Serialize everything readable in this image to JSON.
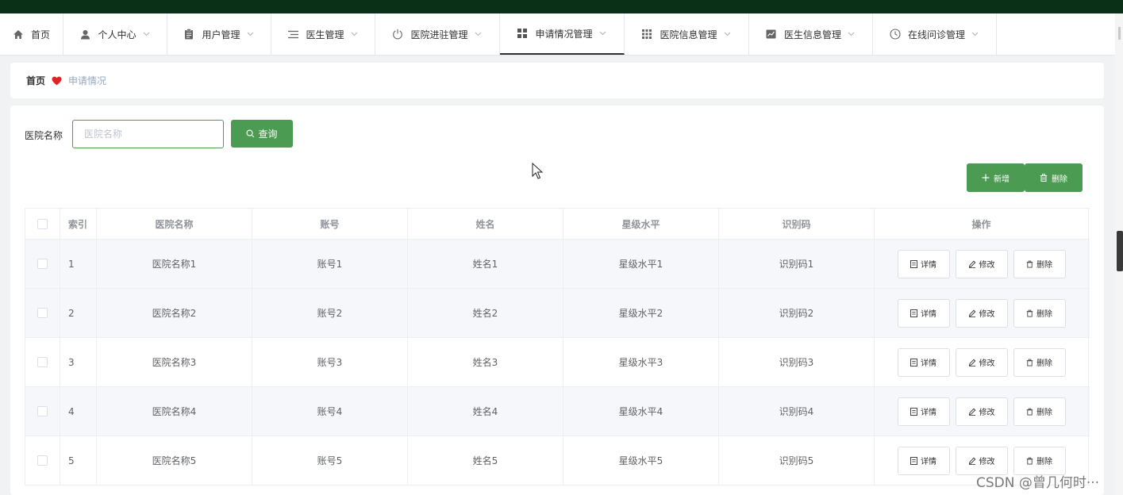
{
  "nav": {
    "items": [
      {
        "label": "首页",
        "icon": "home-icon",
        "chevron": false,
        "active": false
      },
      {
        "label": "个人中心",
        "icon": "user-icon",
        "chevron": true,
        "active": false
      },
      {
        "label": "用户管理",
        "icon": "clipboard-icon",
        "chevron": true,
        "active": false
      },
      {
        "label": "医生管理",
        "icon": "list-icon",
        "chevron": true,
        "active": false
      },
      {
        "label": "医院进驻管理",
        "icon": "power-icon",
        "chevron": true,
        "active": false
      },
      {
        "label": "申请情况管理",
        "icon": "grid-icon",
        "chevron": true,
        "active": true
      },
      {
        "label": "医院信息管理",
        "icon": "apps-icon",
        "chevron": true,
        "active": false
      },
      {
        "label": "医生信息管理",
        "icon": "chart-icon",
        "chevron": true,
        "active": false
      },
      {
        "label": "在线问诊管理",
        "icon": "clock-icon",
        "chevron": true,
        "active": false
      }
    ]
  },
  "breadcrumb": {
    "home": "首页",
    "current": "申请情况"
  },
  "search": {
    "label": "医院名称",
    "placeholder": "医院名称",
    "value": "",
    "button": "查询"
  },
  "actions": {
    "add": "新增",
    "delete": "删除"
  },
  "table": {
    "headers": [
      "索引",
      "医院名称",
      "账号",
      "姓名",
      "星级水平",
      "识别码",
      "操作"
    ],
    "rows": [
      [
        "1",
        "医院名称1",
        "账号1",
        "姓名1",
        "星级水平1",
        "识别码1"
      ],
      [
        "2",
        "医院名称2",
        "账号2",
        "姓名2",
        "星级水平2",
        "识别码2"
      ],
      [
        "3",
        "医院名称3",
        "账号3",
        "姓名3",
        "星级水平3",
        "识别码3"
      ],
      [
        "4",
        "医院名称4",
        "账号4",
        "姓名4",
        "星级水平4",
        "识别码4"
      ],
      [
        "5",
        "医院名称5",
        "账号5",
        "姓名5",
        "星级水平5",
        "识别码5"
      ]
    ],
    "row_actions": {
      "detail": "详情",
      "edit": "修改",
      "delete": "删除"
    }
  },
  "watermark": "CSDN @曾几何时···",
  "colors": {
    "primary": "#4b9b52",
    "topbar": "#0b3018",
    "heart": "#e02424"
  }
}
